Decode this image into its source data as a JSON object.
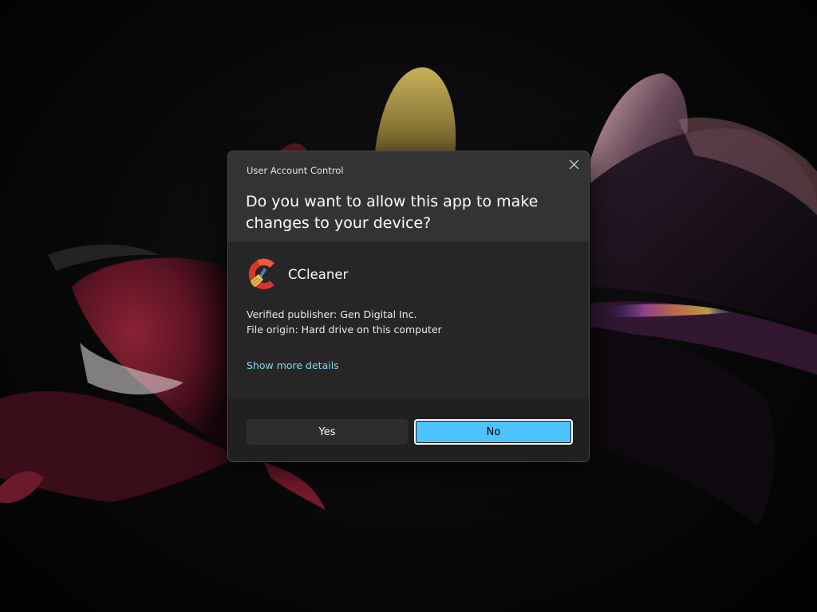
{
  "dialog": {
    "caption": "User Account Control",
    "question": "Do you want to allow this app to make changes to your device?",
    "app_name": "CCleaner",
    "publisher": "Verified publisher: Gen Digital Inc.",
    "origin": "File origin: Hard drive on this computer",
    "details_link": "Show more details",
    "yes_label": "Yes",
    "no_label": "No"
  },
  "icons": {
    "close": "close-icon",
    "app": "ccleaner-logo-icon"
  },
  "colors": {
    "accent": "#4cc2ff",
    "link": "#8fd4ea",
    "dialog_background": "#262626",
    "header_background": "#333333",
    "footer_background": "#202020"
  }
}
